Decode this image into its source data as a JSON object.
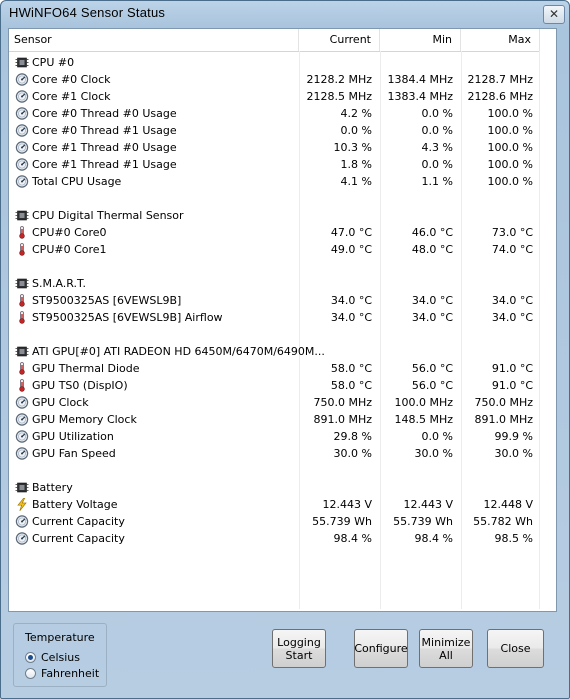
{
  "window": {
    "title": "HWiNFO64 Sensor Status",
    "close_label": "✕"
  },
  "columns": {
    "sensor": "Sensor",
    "current": "Current",
    "min": "Min",
    "max": "Max"
  },
  "rows": [
    {
      "type": "group",
      "icon": "chip-icon",
      "name": "CPU #0"
    },
    {
      "type": "sensor",
      "icon": "gauge-icon",
      "name": "Core #0 Clock",
      "current": "2128.2 MHz",
      "min": "1384.4 MHz",
      "max": "2128.7 MHz"
    },
    {
      "type": "sensor",
      "icon": "gauge-icon",
      "name": "Core #1 Clock",
      "current": "2128.5 MHz",
      "min": "1383.4 MHz",
      "max": "2128.6 MHz"
    },
    {
      "type": "sensor",
      "icon": "gauge-icon",
      "name": "Core #0 Thread #0 Usage",
      "current": "4.2 %",
      "min": "0.0 %",
      "max": "100.0 %"
    },
    {
      "type": "sensor",
      "icon": "gauge-icon",
      "name": "Core #0 Thread #1 Usage",
      "current": "0.0 %",
      "min": "0.0 %",
      "max": "100.0 %"
    },
    {
      "type": "sensor",
      "icon": "gauge-icon",
      "name": "Core #1 Thread #0 Usage",
      "current": "10.3 %",
      "min": "4.3 %",
      "max": "100.0 %"
    },
    {
      "type": "sensor",
      "icon": "gauge-icon",
      "name": "Core #1 Thread #1 Usage",
      "current": "1.8 %",
      "min": "0.0 %",
      "max": "100.0 %"
    },
    {
      "type": "sensor",
      "icon": "gauge-icon",
      "name": "Total CPU Usage",
      "current": "4.1 %",
      "min": "1.1 %",
      "max": "100.0 %"
    },
    {
      "type": "spacer"
    },
    {
      "type": "group",
      "icon": "chip-icon",
      "name": "CPU Digital Thermal Sensor"
    },
    {
      "type": "sensor",
      "icon": "thermometer-icon",
      "name": "CPU#0 Core0",
      "current": "47.0 °C",
      "min": "46.0 °C",
      "max": "73.0 °C"
    },
    {
      "type": "sensor",
      "icon": "thermometer-icon",
      "name": "CPU#0 Core1",
      "current": "49.0 °C",
      "min": "48.0 °C",
      "max": "74.0 °C"
    },
    {
      "type": "spacer"
    },
    {
      "type": "group",
      "icon": "chip-icon",
      "name": "S.M.A.R.T."
    },
    {
      "type": "sensor",
      "icon": "thermometer-icon",
      "name": "ST9500325AS [6VEWSL9B]",
      "current": "34.0 °C",
      "min": "34.0 °C",
      "max": "34.0 °C"
    },
    {
      "type": "sensor",
      "icon": "thermometer-icon",
      "name": "ST9500325AS [6VEWSL9B] Airflow",
      "current": "34.0 °C",
      "min": "34.0 °C",
      "max": "34.0 °C"
    },
    {
      "type": "spacer"
    },
    {
      "type": "group",
      "icon": "chip-icon",
      "name": "ATI GPU[#0] ATI RADEON HD 6450M/6470M/6490M..."
    },
    {
      "type": "sensor",
      "icon": "thermometer-icon",
      "name": "GPU Thermal Diode",
      "current": "58.0 °C",
      "min": "56.0 °C",
      "max": "91.0 °C"
    },
    {
      "type": "sensor",
      "icon": "thermometer-icon",
      "name": "GPU TS0 (DispIO)",
      "current": "58.0 °C",
      "min": "56.0 °C",
      "max": "91.0 °C"
    },
    {
      "type": "sensor",
      "icon": "gauge-icon",
      "name": "GPU Clock",
      "current": "750.0 MHz",
      "min": "100.0 MHz",
      "max": "750.0 MHz"
    },
    {
      "type": "sensor",
      "icon": "gauge-icon",
      "name": "GPU Memory Clock",
      "current": "891.0 MHz",
      "min": "148.5 MHz",
      "max": "891.0 MHz"
    },
    {
      "type": "sensor",
      "icon": "gauge-icon",
      "name": "GPU Utilization",
      "current": "29.8 %",
      "min": "0.0 %",
      "max": "99.9 %"
    },
    {
      "type": "sensor",
      "icon": "gauge-icon",
      "name": "GPU Fan Speed",
      "current": "30.0 %",
      "min": "30.0 %",
      "max": "30.0 %"
    },
    {
      "type": "spacer"
    },
    {
      "type": "group",
      "icon": "chip-icon",
      "name": "Battery"
    },
    {
      "type": "sensor",
      "icon": "lightning-icon",
      "name": "Battery Voltage",
      "current": "12.443 V",
      "min": "12.443 V",
      "max": "12.448 V"
    },
    {
      "type": "sensor",
      "icon": "gauge-icon",
      "name": "Current Capacity",
      "current": "55.739 Wh",
      "min": "55.739 Wh",
      "max": "55.782 Wh"
    },
    {
      "type": "sensor",
      "icon": "gauge-icon",
      "name": "Current Capacity",
      "current": "98.4 %",
      "min": "98.4 %",
      "max": "98.5 %"
    }
  ],
  "temperature": {
    "legend": "Temperature",
    "options": [
      {
        "label": "Celsius",
        "checked": true
      },
      {
        "label": "Fahrenheit",
        "checked": false
      }
    ]
  },
  "buttons": {
    "logging": "Logging\nStart",
    "configure": "Configure",
    "minimize": "Minimize\nAll",
    "close": "Close"
  }
}
